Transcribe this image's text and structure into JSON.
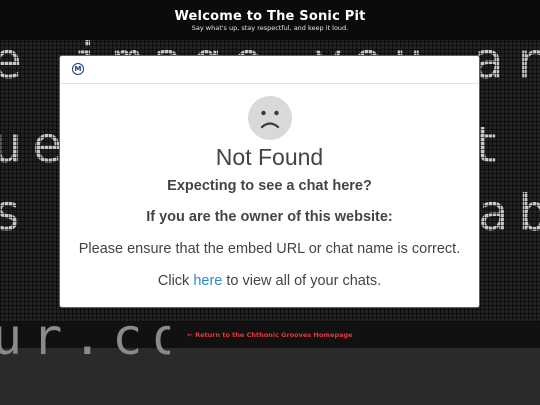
{
  "header": {
    "title": "Welcome to The Sonic Pit",
    "subtitle": "Say what's up, stay respectful, and keep it loud."
  },
  "background_text": {
    "line1": "e image you are",
    "line2": "ue",
    "line2b": "t e",
    "line3": "s n",
    "line3b": "ab",
    "line4": "ur.com"
  },
  "footer": {
    "link_text": "← Return to the Chthonic Grooves Homepage"
  },
  "modal": {
    "logo_letter": "M",
    "title": "Not Found",
    "question": "Expecting to see a chat here?",
    "owner_heading": "If you are the owner of this website:",
    "ensure_text": "Please ensure that the embed URL or chat name is correct.",
    "click_prefix": "Click ",
    "click_link": "here",
    "click_suffix": " to view all of your chats."
  },
  "colors": {
    "modal_border": "#c0392b",
    "link_blue": "#2a8bd0",
    "footer_link_red": "#e23a3a",
    "header_bg": "#0b0b0b"
  },
  "icons": {
    "modal_logo": "minnit-logo-icon",
    "status": "sad-face-icon"
  }
}
